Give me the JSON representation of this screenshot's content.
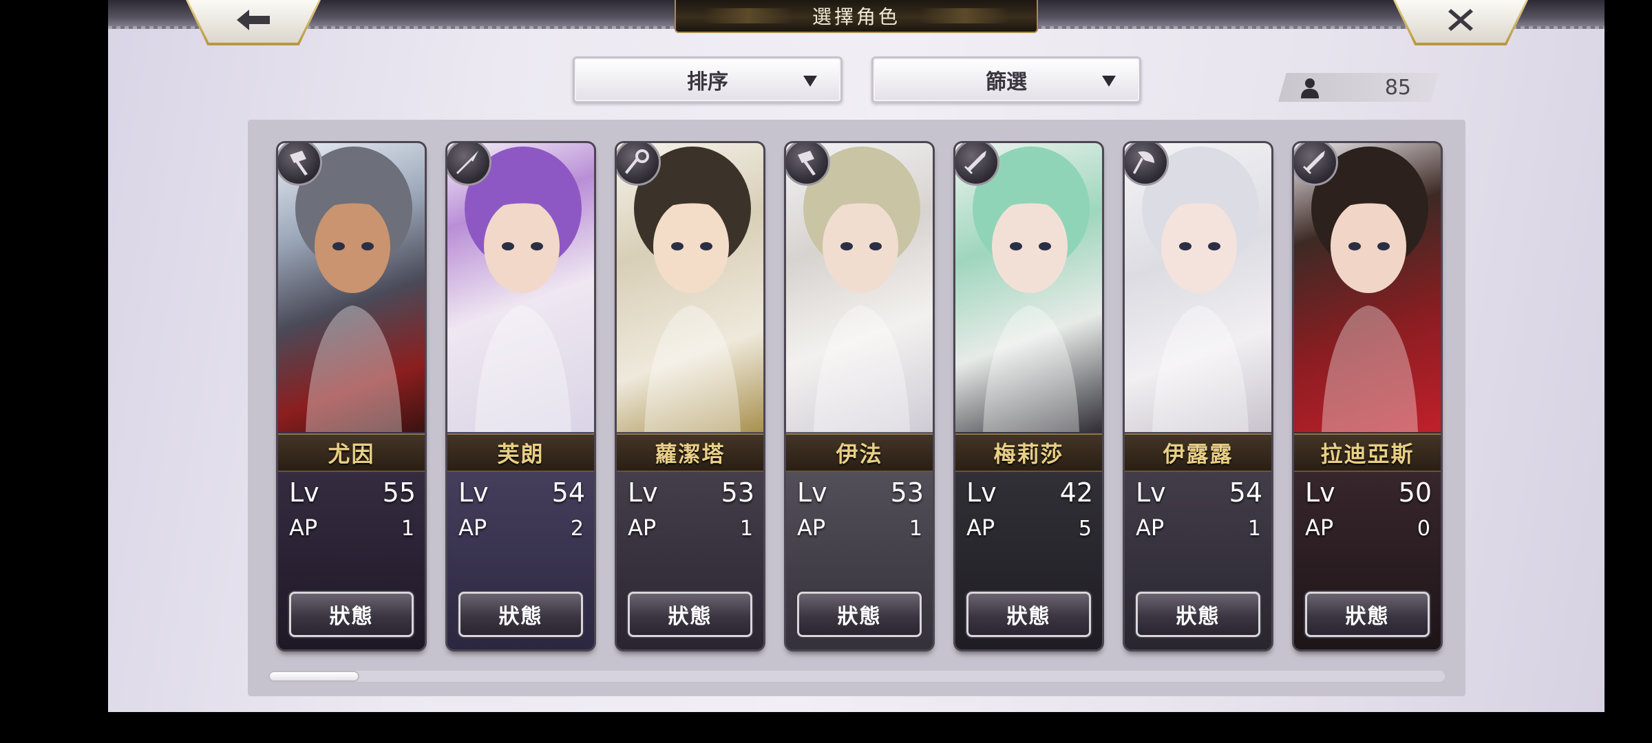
{
  "header": {
    "title": "選擇角色",
    "back_icon": "arrow-left-icon",
    "close_icon": "close-x-icon"
  },
  "controls": {
    "sort_label": "排序",
    "filter_label": "篩選",
    "roster_count": "85",
    "roster_icon": "person-icon"
  },
  "colors": {
    "gold_accent": "#e9cf86",
    "panel_bg": "#c7c3ce"
  },
  "characters": [
    {
      "name": "尤因",
      "lv_label": "Lv",
      "lv": "55",
      "ap_label": "AP",
      "ap": "1",
      "status_label": "狀態",
      "class_icon": "hammer-icon"
    },
    {
      "name": "芙朗",
      "lv_label": "Lv",
      "lv": "54",
      "ap_label": "AP",
      "ap": "2",
      "status_label": "狀態",
      "class_icon": "spear-icon"
    },
    {
      "name": "蘿潔塔",
      "lv_label": "Lv",
      "lv": "53",
      "ap_label": "AP",
      "ap": "1",
      "status_label": "狀態",
      "class_icon": "staff-icon"
    },
    {
      "name": "伊法",
      "lv_label": "Lv",
      "lv": "53",
      "ap_label": "AP",
      "ap": "1",
      "status_label": "狀態",
      "class_icon": "hammer-icon"
    },
    {
      "name": "梅莉莎",
      "lv_label": "Lv",
      "lv": "42",
      "ap_label": "AP",
      "ap": "5",
      "status_label": "狀態",
      "class_icon": "sword-icon"
    },
    {
      "name": "伊露露",
      "lv_label": "Lv",
      "lv": "54",
      "ap_label": "AP",
      "ap": "1",
      "status_label": "狀態",
      "class_icon": "axe-icon"
    },
    {
      "name": "拉迪亞斯",
      "lv_label": "Lv",
      "lv": "50",
      "ap_label": "AP",
      "ap": "0",
      "status_label": "狀態",
      "class_icon": "sword-icon"
    }
  ],
  "scroll": {
    "position": 0.0
  }
}
